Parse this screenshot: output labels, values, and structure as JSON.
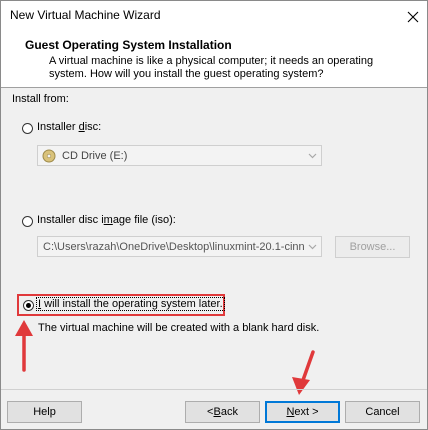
{
  "window": {
    "title": "New Virtual Machine Wizard"
  },
  "header": {
    "title": "Guest Operating System Installation",
    "description": "A virtual machine is like a physical computer; it needs an operating system. How will you install the guest operating system?"
  },
  "install_from_label": "Install from:",
  "options": {
    "disc": {
      "label_pre": "Installer ",
      "label_u": "d",
      "label_post": "isc:",
      "selected": false,
      "drive_value": "CD Drive (E:)"
    },
    "iso": {
      "label_pre": "Installer disc i",
      "label_u": "m",
      "label_post": "age file (iso):",
      "selected": false,
      "path_value": "C:\\Users\\razah\\OneDrive\\Desktop\\linuxmint-20.1-cinn",
      "browse_label": "Browse..."
    },
    "later": {
      "label_u": "I",
      "label_post": " will install the operating system later.",
      "selected": true,
      "note": "The virtual machine will be created with a blank hard disk."
    }
  },
  "buttons": {
    "help": "Help",
    "back_pre": "< ",
    "back_u": "B",
    "back_post": "ack",
    "next_u": "N",
    "next_post": "ext >",
    "cancel": "Cancel"
  },
  "colors": {
    "annotation": "#e0393b",
    "focus": "#0078d7"
  }
}
